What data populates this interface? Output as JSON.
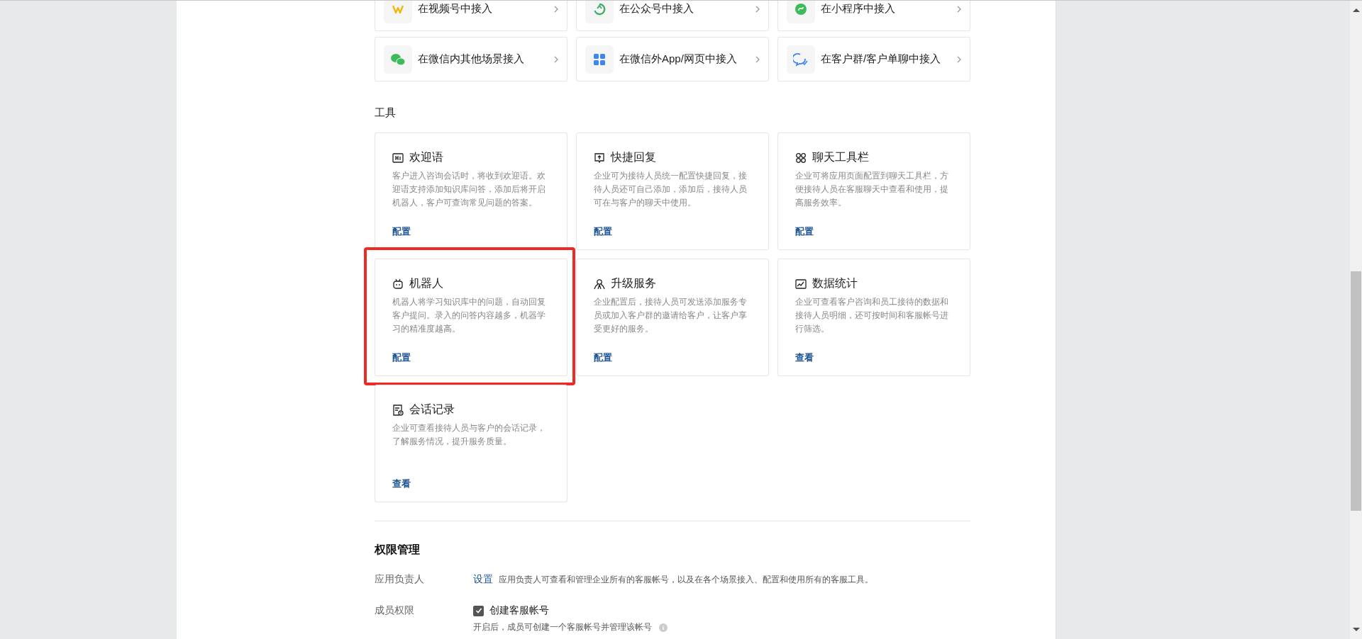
{
  "access_channels": [
    {
      "title": "在视频号中接入"
    },
    {
      "title": "在公众号中接入"
    },
    {
      "title": "在小程序中接入"
    },
    {
      "title": "在微信内其他场景接入"
    },
    {
      "title": "在微信外App/网页中接入"
    },
    {
      "title": "在客户群/客户单聊中接入"
    }
  ],
  "tools_heading": "工具",
  "tools": [
    {
      "title": "欢迎语",
      "description": "客户进入咨询会话时，将收到欢迎语。欢迎语支持添加知识库问答，添加后将开启机器人，客户可查询常见问题的答案。",
      "action": "配置",
      "highlighted": false
    },
    {
      "title": "快捷回复",
      "description": "企业可为接待人员统一配置快捷回复，接待人员还可自己添加，添加后，接待人员可在与客户的聊天中使用。",
      "action": "配置",
      "highlighted": false
    },
    {
      "title": "聊天工具栏",
      "description": "企业可将应用页面配置到聊天工具栏，方便接待人员在客服聊天中查看和使用，提高服务效率。",
      "action": "配置",
      "highlighted": false
    },
    {
      "title": "机器人",
      "description": "机器人将学习知识库中的问题，自动回复客户提问。录入的问答内容越多，机器学习的精准度越高。",
      "action": "配置",
      "highlighted": true
    },
    {
      "title": "升级服务",
      "description": "企业配置后，接待人员可发送添加服务专员或加入客户群的邀请给客户，让客户享受更好的服务。",
      "action": "配置",
      "highlighted": false
    },
    {
      "title": "数据统计",
      "description": "企业可查看客户咨询和员工接待的数据和接待人员明细，还可按时间和客服帐号进行筛选。",
      "action": "查看",
      "highlighted": false
    },
    {
      "title": "会话记录",
      "description": "企业可查看接待人员与客户的会话记录，了解服务情况，提升服务质量。",
      "action": "查看",
      "highlighted": false
    }
  ],
  "permissions": {
    "heading": "权限管理",
    "rows": [
      {
        "kind": "link",
        "label": "应用负责人",
        "link": "设置",
        "description": "应用负责人可查看和管理企业所有的客服帐号，以及在各个场景接入、配置和使用所有的客服工具。"
      },
      {
        "kind": "checkbox",
        "label": "成员权限",
        "option": "创建客服帐号",
        "checked": true,
        "note": "开启后，成员可创建一个客服帐号并管理该帐号"
      }
    ]
  }
}
